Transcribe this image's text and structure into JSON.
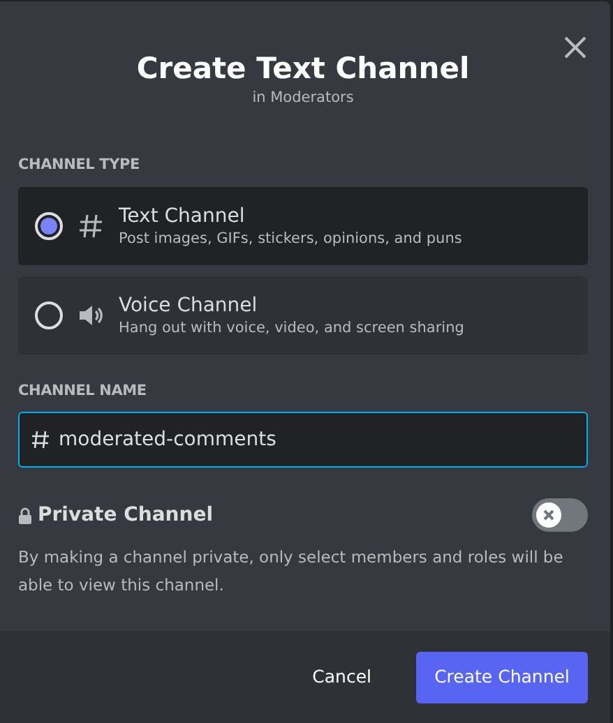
{
  "dialog": {
    "title": "Create Text Channel",
    "subtitle": "in Moderators"
  },
  "channel_type": {
    "label": "CHANNEL TYPE",
    "options": [
      {
        "kind": "text",
        "name": "Text Channel",
        "description": "Post images, GIFs, stickers, opinions, and puns",
        "selected": true
      },
      {
        "kind": "voice",
        "name": "Voice Channel",
        "description": "Hang out with voice, video, and screen sharing",
        "selected": false
      }
    ]
  },
  "channel_name": {
    "label": "CHANNEL NAME",
    "value": "moderated-comments"
  },
  "private_channel": {
    "label": "Private Channel",
    "on": false,
    "description": "By making a channel private, only select members and roles will be able to view this channel."
  },
  "buttons": [
    {
      "kind": "secondary",
      "label": "Cancel"
    },
    {
      "kind": "primary",
      "label": "Create Channel"
    }
  ]
}
